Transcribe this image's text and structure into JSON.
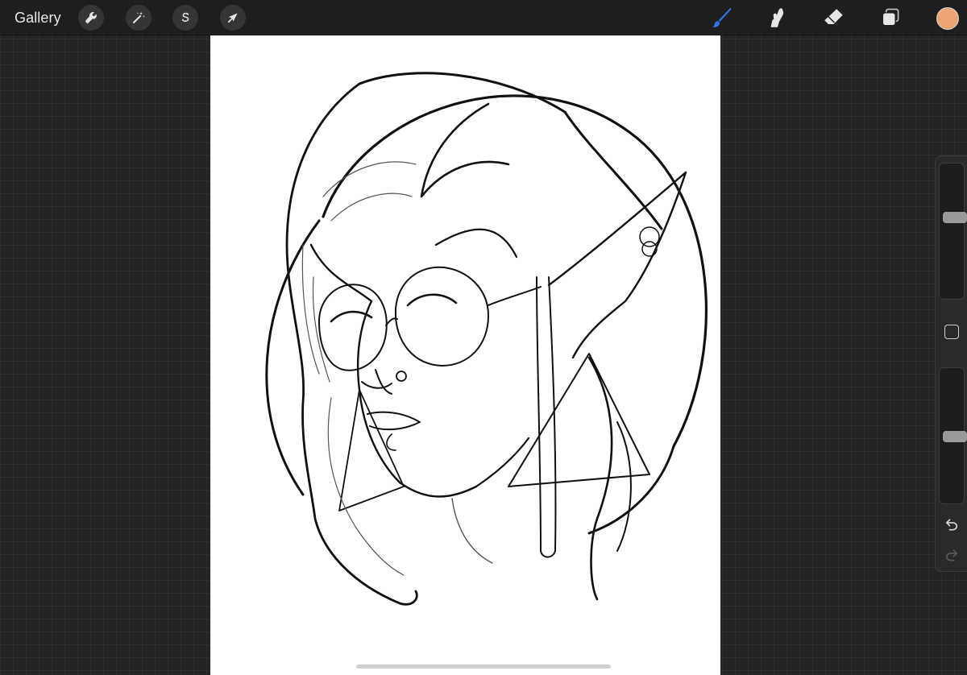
{
  "topbar": {
    "gallery_label": "Gallery",
    "left_tools": [
      {
        "name": "actions",
        "icon": "wrench-icon"
      },
      {
        "name": "adjustments",
        "icon": "magic-wand-icon"
      },
      {
        "name": "selection",
        "icon": "selection-s-icon"
      },
      {
        "name": "transform",
        "icon": "arrow-cursor-icon"
      }
    ],
    "right_tools": [
      {
        "name": "brush",
        "icon": "brush-icon",
        "active": true
      },
      {
        "name": "smudge",
        "icon": "smudge-icon"
      },
      {
        "name": "eraser",
        "icon": "eraser-icon"
      },
      {
        "name": "layers",
        "icon": "layers-icon"
      }
    ],
    "current_color": "#EDA574",
    "accent_color": "#2F74E6"
  },
  "sidebar": {
    "brush_size_level": 0.62,
    "opacity_level": 0.5,
    "modify_button": "square-icon",
    "undo_icon": "undo-icon",
    "redo_icon": "redo-icon"
  },
  "canvas": {
    "background": "#FFFFFF",
    "content": "lineart-portrait"
  }
}
